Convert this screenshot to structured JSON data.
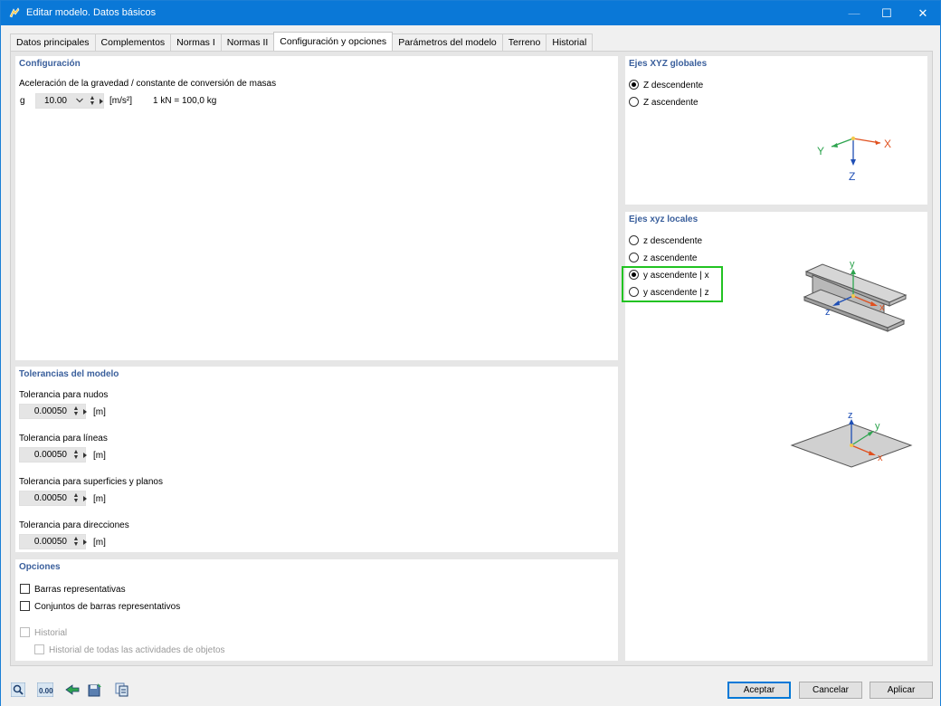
{
  "window": {
    "title": "Editar modelo. Datos básicos",
    "minimize_glyph": "—",
    "maximize_glyph": "☐",
    "close_glyph": "✕"
  },
  "tabs": [
    {
      "label": "Datos principales"
    },
    {
      "label": "Complementos"
    },
    {
      "label": "Normas I"
    },
    {
      "label": "Normas II"
    },
    {
      "label": "Configuración y opciones",
      "active": true
    },
    {
      "label": "Parámetros del modelo"
    },
    {
      "label": "Terreno"
    },
    {
      "label": "Historial"
    }
  ],
  "configuracion": {
    "title": "Configuración",
    "gravity_label": "Aceleración de la gravedad / constante de conversión de masas",
    "g_symbol": "g",
    "g_value": "10.00",
    "g_unit": "[m/s²]",
    "conversion_note": "1 kN = 100,0 kg"
  },
  "tolerancias": {
    "title": "Tolerancias del modelo",
    "items": [
      {
        "label": "Tolerancia para nudos",
        "value": "0.00050",
        "unit": "[m]"
      },
      {
        "label": "Tolerancia para líneas",
        "value": "0.00050",
        "unit": "[m]"
      },
      {
        "label": "Tolerancia para superficies y planos",
        "value": "0.00050",
        "unit": "[m]"
      },
      {
        "label": "Tolerancia para direcciones",
        "value": "0.00050",
        "unit": "[m]"
      }
    ]
  },
  "opciones": {
    "title": "Opciones",
    "barras_representativas": "Barras representativas",
    "conjuntos_barras": "Conjuntos de barras representativos",
    "historial": "Historial",
    "historial_todas": "Historial de todas las actividades de objetos"
  },
  "ejes_globales": {
    "title": "Ejes XYZ globales",
    "options": [
      "Z descendente",
      "Z ascendente"
    ],
    "selected": 0,
    "axis_x": "X",
    "axis_y": "Y",
    "axis_z": "Z"
  },
  "ejes_locales": {
    "title": "Ejes xyz locales",
    "options": [
      "z descendente",
      "z ascendente",
      "y ascendente | x",
      "y ascendente | z"
    ],
    "selected": 2,
    "axis_x": "x",
    "axis_y": "y",
    "axis_z": "z"
  },
  "footer": {
    "aceptar": "Aceptar",
    "cancelar": "Cancelar",
    "aplicar": "Aplicar",
    "tool_units_label": "0.00"
  },
  "colors": {
    "title_bar": "#0a78d7",
    "section_title": "#3a5f9c",
    "highlight": "#22c322",
    "axis_x": "#e0501e",
    "axis_y": "#2ea44f",
    "axis_z": "#1f4fb5"
  }
}
